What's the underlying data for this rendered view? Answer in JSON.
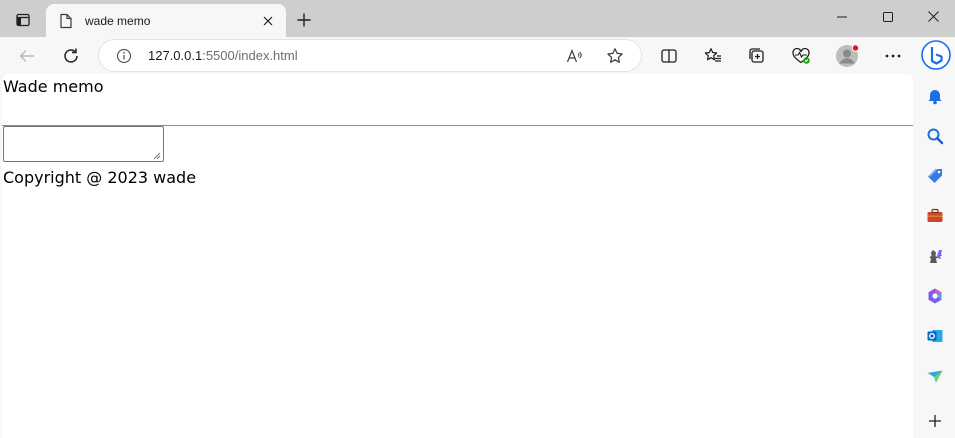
{
  "browser": {
    "tab": {
      "title": "wade memo",
      "icon": "document-icon"
    },
    "address": {
      "host": "127.0.0.1",
      "rest": ":5500/index.html"
    },
    "colors": {
      "profile_dot": "#e81123",
      "health_badge": "#13a10e",
      "bing_blue": "#1b6ee3"
    }
  },
  "page": {
    "title": "Wade memo",
    "memo_input": {
      "value": "",
      "placeholder": ""
    },
    "footer": "Copyright @ 2023 wade"
  },
  "sidebar": {
    "items": [
      "notifications-icon",
      "search-icon",
      "shopping-icon",
      "tools-icon",
      "games-icon",
      "office-icon",
      "outlook-icon",
      "drop-icon",
      "add-icon"
    ]
  }
}
